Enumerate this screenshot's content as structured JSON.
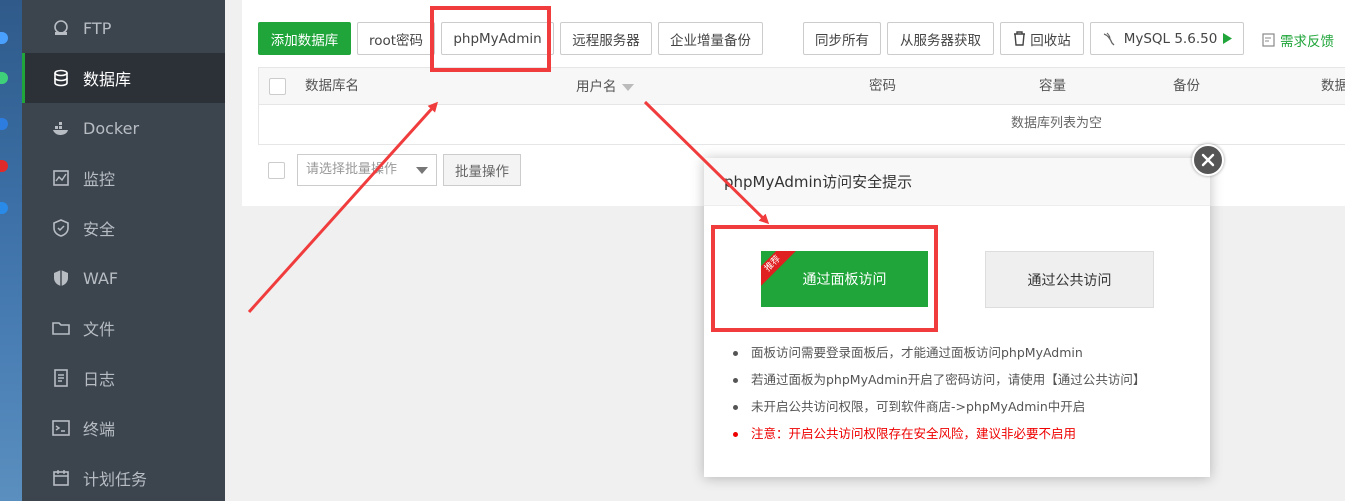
{
  "sidebar": {
    "items": [
      {
        "label": "FTP",
        "icon": "ftp-icon"
      },
      {
        "label": "数据库",
        "icon": "database-icon",
        "active": true
      },
      {
        "label": "Docker",
        "icon": "docker-icon"
      },
      {
        "label": "监控",
        "icon": "monitor-icon"
      },
      {
        "label": "安全",
        "icon": "security-icon"
      },
      {
        "label": "WAF",
        "icon": "waf-shield-icon"
      },
      {
        "label": "文件",
        "icon": "folder-icon"
      },
      {
        "label": "日志",
        "icon": "log-icon"
      },
      {
        "label": "终端",
        "icon": "terminal-icon"
      },
      {
        "label": "计划任务",
        "icon": "calendar-icon"
      }
    ]
  },
  "toolbar": {
    "add_db": "添加数据库",
    "root_pwd": "root密码",
    "phpmyadmin": "phpMyAdmin",
    "remote_server": "远程服务器",
    "enterprise_backup": "企业增量备份",
    "sync_all": "同步所有",
    "fetch_from_server": "从服务器获取",
    "recycle_bin": "回收站",
    "mysql_version": "MySQL 5.6.50",
    "feedback": "需求反馈"
  },
  "table": {
    "headers": [
      "数据库名",
      "用户名",
      "密码",
      "容量",
      "备份",
      "数据"
    ],
    "empty_text": "数据库列表为空"
  },
  "batch": {
    "placeholder": "请选择批量操作",
    "button": "批量操作"
  },
  "modal": {
    "title": "phpMyAdmin访问安全提示",
    "panel_button": "通过面板访问",
    "ribbon": "推荐",
    "public_button": "通过公共访问",
    "notes": [
      "面板访问需要登录面板后，才能通过面板访问phpMyAdmin",
      "若通过面板为phpMyAdmin开启了密码访问，请使用【通过公共访问】",
      "未开启公共访问权限，可到软件商店->phpMyAdmin中开启"
    ],
    "warning": "注意：开启公共访问权限存在安全风险，建议非必要不启用"
  },
  "colors": {
    "accent": "#20a53a",
    "highlight": "#f03c3c",
    "sidebar_bg": "#3c444d"
  }
}
